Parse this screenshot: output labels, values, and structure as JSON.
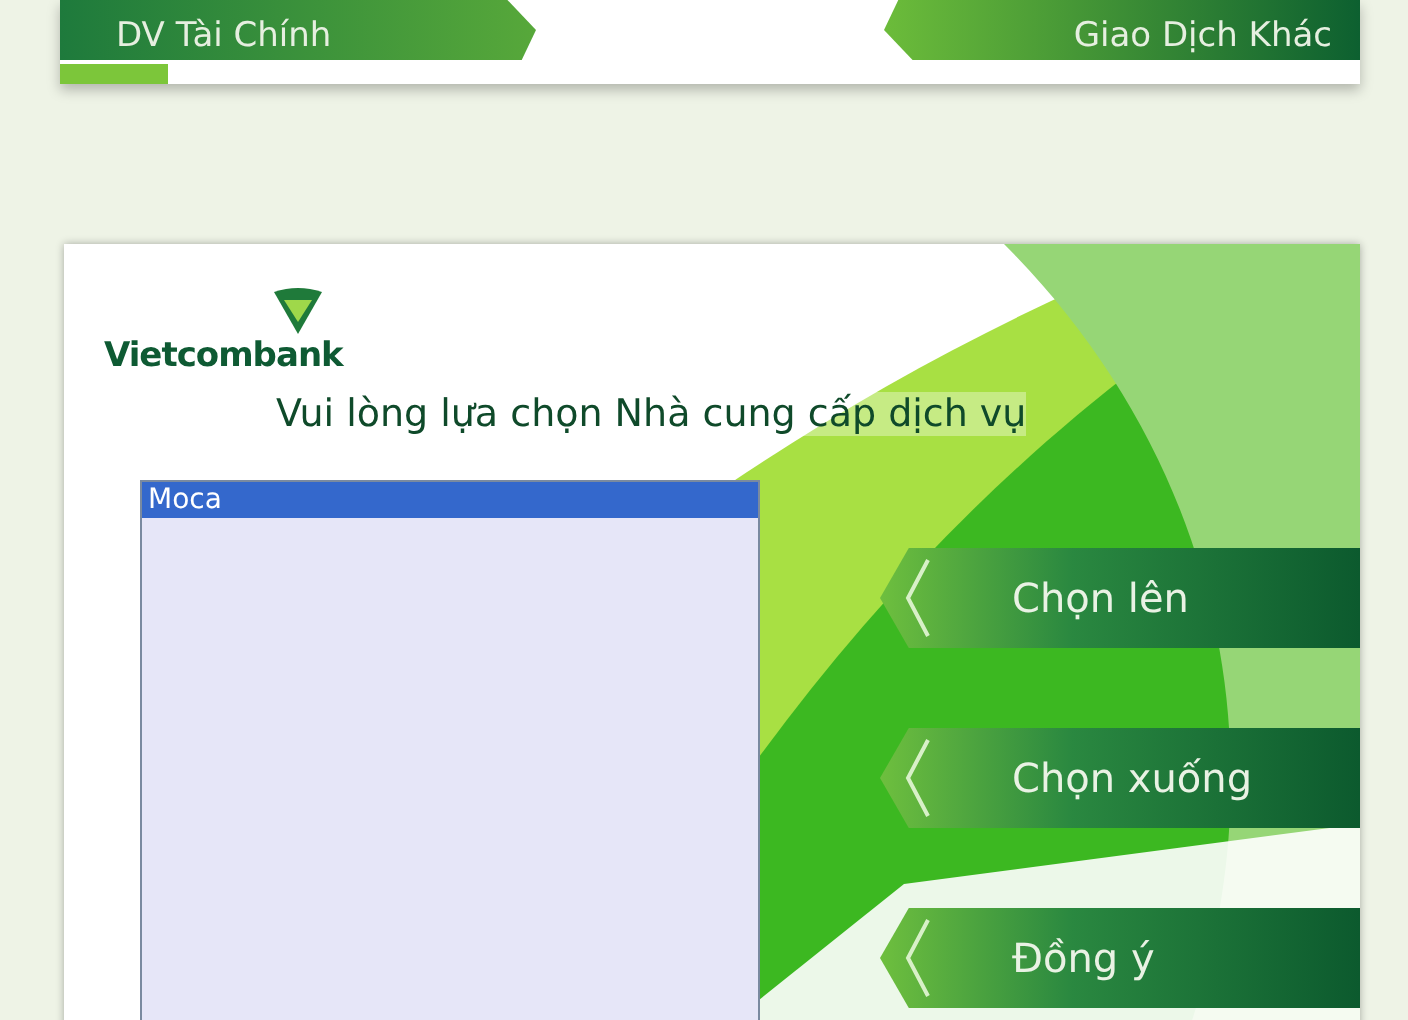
{
  "top_screen": {
    "buttons": [
      {
        "label": "DV Tài Chính"
      },
      {
        "label": "Giao Dịch Khác"
      }
    ]
  },
  "screen": {
    "logo": "Vietcombank",
    "title": "Vui lòng lựa chọn Nhà cung cấp dịch vụ",
    "providers": [
      {
        "label": "Moca",
        "selected": true
      }
    ],
    "buttons": [
      "Chọn lên",
      "Chọn xuống",
      "Đồng ý"
    ]
  }
}
